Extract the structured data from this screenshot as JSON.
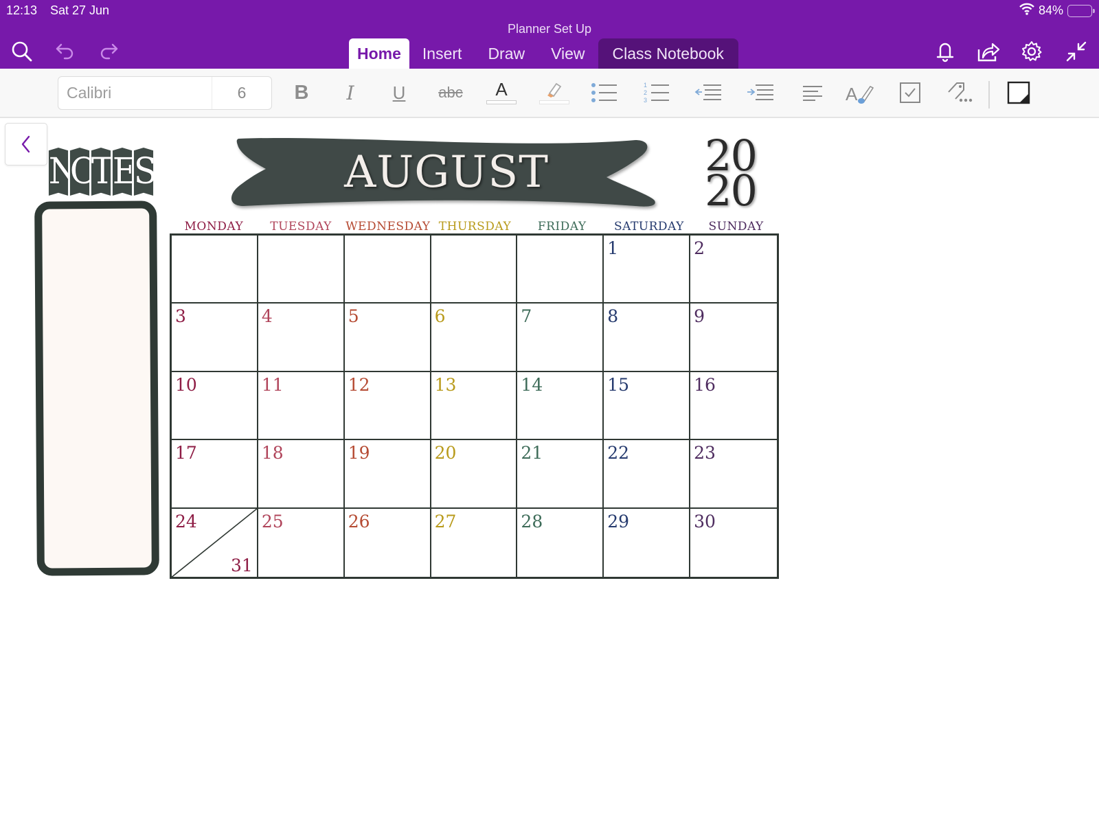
{
  "status_bar": {
    "time": "12:13",
    "date": "Sat 27 Jun",
    "battery_text": "84%",
    "battery_level": 0.84
  },
  "header": {
    "document_title": "Planner Set Up",
    "icons_left": [
      "search-icon",
      "undo-icon",
      "redo-icon"
    ],
    "icons_right": [
      "bell-icon",
      "share-icon",
      "gear-icon",
      "collapse-icon"
    ],
    "tabs": [
      {
        "label": "Home",
        "active": true
      },
      {
        "label": "Insert",
        "active": false
      },
      {
        "label": "Draw",
        "active": false
      },
      {
        "label": "View",
        "active": false
      },
      {
        "label": "Class Notebook",
        "active": false
      }
    ]
  },
  "ribbon": {
    "font_name": "Calibri",
    "font_size": "6",
    "buttons": [
      "bold",
      "italic",
      "underline",
      "strikethrough",
      "font-color",
      "highlight",
      "bulleted-list",
      "numbered-list",
      "outdent",
      "indent",
      "align",
      "styles",
      "to-do-tag",
      "more-tags",
      "sticky-note"
    ],
    "labels": {
      "bold": "B",
      "italic": "I",
      "underline": "U",
      "strikethrough": "abc",
      "font_color": "A"
    }
  },
  "page": {
    "notes_title": "NOTES",
    "notes_letters": [
      "N",
      "O",
      "T",
      "E",
      "S"
    ],
    "month": "AUGUST",
    "year_top": "20",
    "year_bottom": "20",
    "banner_color": "#3f4a46",
    "weekdays": [
      {
        "label": "MONDAY",
        "color": "#8e1d45"
      },
      {
        "label": "TUESDAY",
        "color": "#b0445a"
      },
      {
        "label": "WEDNESDAY",
        "color": "#b54a32"
      },
      {
        "label": "THURSDAY",
        "color": "#b89a1a"
      },
      {
        "label": "FRIDAY",
        "color": "#3d6b58"
      },
      {
        "label": "SATURDAY",
        "color": "#253a6e"
      },
      {
        "label": "SUNDAY",
        "color": "#4e2c5f"
      }
    ],
    "weeks": [
      [
        "",
        "",
        "",
        "",
        "",
        "1",
        "2"
      ],
      [
        "3",
        "4",
        "5",
        "6",
        "7",
        "8",
        "9"
      ],
      [
        "10",
        "11",
        "12",
        "13",
        "14",
        "15",
        "16"
      ],
      [
        "17",
        "18",
        "19",
        "20",
        "21",
        "22",
        "23"
      ],
      [
        "24",
        "25",
        "26",
        "27",
        "28",
        "29",
        "30"
      ]
    ],
    "split_cell": {
      "top": "24",
      "bottom": "31"
    }
  }
}
